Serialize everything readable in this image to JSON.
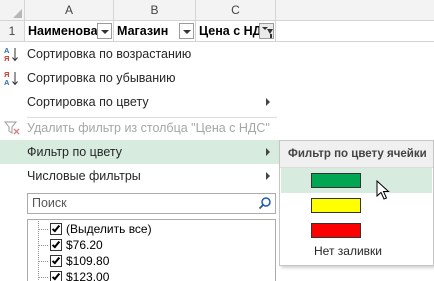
{
  "sheet": {
    "columns": [
      "A",
      "B",
      "C"
    ],
    "row_number": "1",
    "headers": [
      "Наименовані",
      "Магазин",
      "Цена с НДС"
    ]
  },
  "menu": {
    "items": [
      {
        "label": "Сортировка по возрастанию",
        "icon": "sort-ascending-icon"
      },
      {
        "label": "Сортировка по убыванию",
        "icon": "sort-descending-icon"
      },
      {
        "label": "Сортировка по цвету",
        "submenu": true
      },
      {
        "label": "Удалить фильтр из столбца \"Цена с НДС\"",
        "icon": "clear-filter-icon",
        "disabled": true
      },
      {
        "label": "Фильтр по цвету",
        "submenu": true,
        "highlighted": true
      },
      {
        "label": "Числовые фильтры",
        "submenu": true
      }
    ],
    "search": {
      "placeholder": "Поиск",
      "icon": "search-icon"
    },
    "values": [
      {
        "label": "(Выделить все)",
        "checked": true
      },
      {
        "label": "$76.20",
        "checked": true
      },
      {
        "label": "$109.80",
        "checked": true
      },
      {
        "label": "$123.00",
        "checked": true
      }
    ]
  },
  "color_submenu": {
    "title": "Фильтр по цвету ячейки",
    "swatches": [
      "#00a651",
      "#ffff00",
      "#ff0000"
    ],
    "no_fill_label": "Нет заливки"
  },
  "colors": {
    "highlight": "#d7ecdf",
    "sort_icon_blue": "#2f6db5",
    "sort_icon_red": "#c0392b"
  }
}
